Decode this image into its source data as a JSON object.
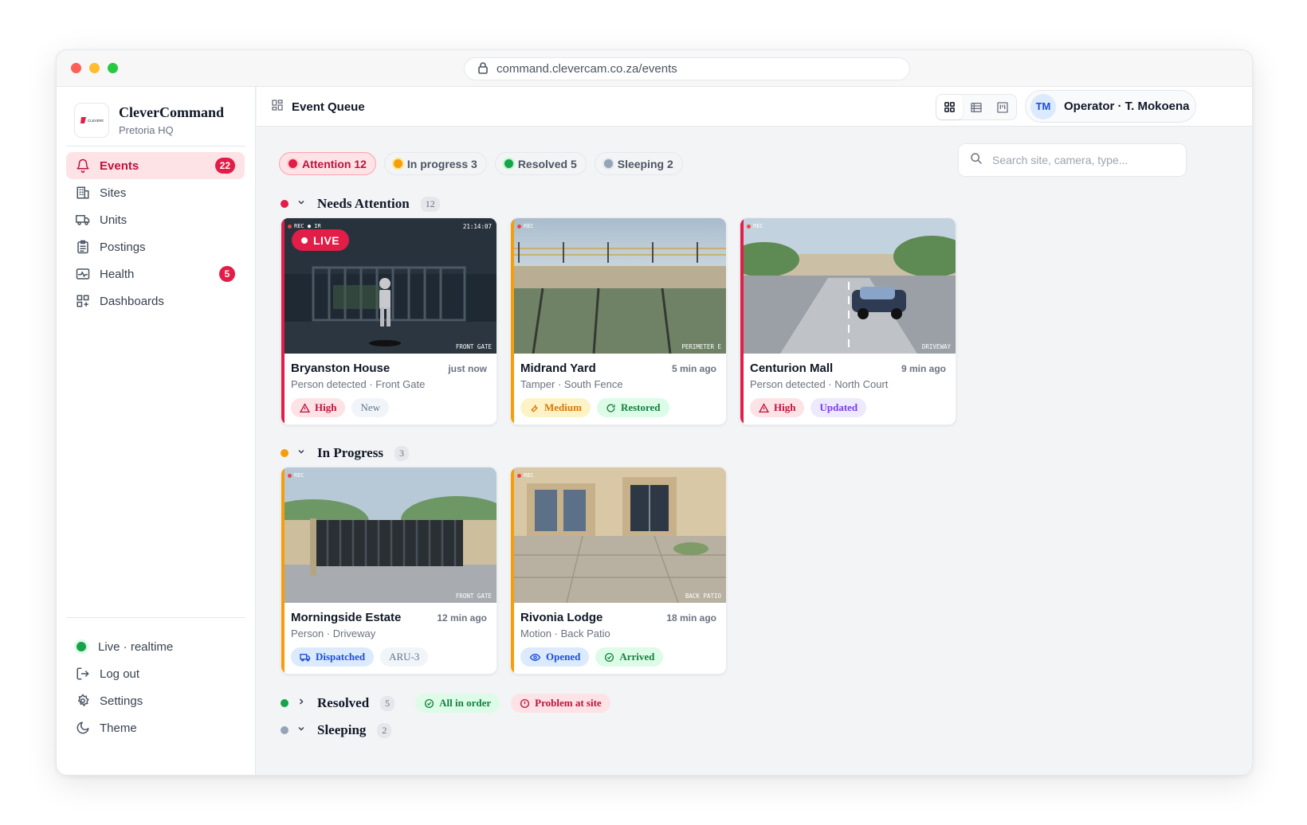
{
  "browser": {
    "url": "command.clevercam.co.za/events"
  },
  "brand": {
    "name": "CleverCommand",
    "sub": "Pretoria HQ",
    "logo_text": "CLEVERCAM"
  },
  "nav": {
    "items": [
      {
        "label": "Events",
        "badge": "22",
        "icon": "bell-icon"
      },
      {
        "label": "Sites",
        "icon": "building-icon"
      },
      {
        "label": "Units",
        "icon": "truck-icon"
      },
      {
        "label": "Postings",
        "icon": "clipboard-icon"
      },
      {
        "label": "Health",
        "badge": "5",
        "icon": "pulse-icon"
      },
      {
        "label": "Dashboards",
        "icon": "dashboard-icon"
      }
    ],
    "bottom": [
      {
        "label": "Live · realtime",
        "icon": "status-dot-icon"
      },
      {
        "label": "Log out",
        "icon": "logout-icon"
      },
      {
        "label": "Settings",
        "icon": "gear-icon"
      },
      {
        "label": "Theme",
        "icon": "moon-icon"
      }
    ]
  },
  "topbar": {
    "title": "Event Queue",
    "user_initials": "TM",
    "user_label": "Operator · T. Mokoena"
  },
  "filters": [
    {
      "label": "Attention 12",
      "color": "#e11d48"
    },
    {
      "label": "In progress 3",
      "color": "#f59e0b"
    },
    {
      "label": "Resolved 5",
      "color": "#16a34a"
    },
    {
      "label": "Sleeping 2",
      "color": "#94a3b8"
    }
  ],
  "search": {
    "placeholder": "Search site, camera, type..."
  },
  "sections": {
    "attention": {
      "title": "Needs Attention",
      "count": "12",
      "color": "#e11d48"
    },
    "progress": {
      "title": "In Progress",
      "count": "3",
      "color": "#f59e0b"
    },
    "resolved": {
      "title": "Resolved",
      "count": "5",
      "color": "#16a34a",
      "pills": [
        "All in order",
        "Problem at site"
      ]
    },
    "sleeping": {
      "title": "Sleeping",
      "count": "2",
      "color": "#94a3b8"
    }
  },
  "cards": [
    {
      "site": "Bryanston House",
      "time": "just now",
      "sub": "Person detected · Front Gate",
      "cam_label": "FRONT GATE",
      "rec": "REC ● IR",
      "cam_time": "21:14:07",
      "live": "LIVE",
      "tags": [
        "High",
        "New"
      ],
      "accent": "#e11d48"
    },
    {
      "site": "Midrand Yard",
      "time": "5 min ago",
      "sub": "Tamper · South Fence",
      "cam_label": "PERIMETER E",
      "rec": "REC",
      "tags": [
        "Medium",
        "Restored"
      ],
      "accent": "#f59e0b"
    },
    {
      "site": "Centurion Mall",
      "time": "9 min ago",
      "sub": "Person detected · North Court",
      "cam_label": "DRIVEWAY",
      "rec": "REC",
      "tags": [
        "High",
        "Updated"
      ],
      "accent": "#e11d48"
    },
    {
      "site": "Morningside Estate",
      "time": "12 min ago",
      "sub": "Person · Driveway",
      "cam_label": "FRONT GATE",
      "rec": "REC",
      "tags": [
        "Dispatched",
        "ARU-3"
      ],
      "accent": "#f59e0b"
    },
    {
      "site": "Rivonia Lodge",
      "time": "18 min ago",
      "sub": "Motion · Back Patio",
      "cam_label": "BACK PATIO",
      "rec": "REC",
      "tags": [
        "Opened",
        "Arrived"
      ],
      "accent": "#f59e0b"
    }
  ]
}
